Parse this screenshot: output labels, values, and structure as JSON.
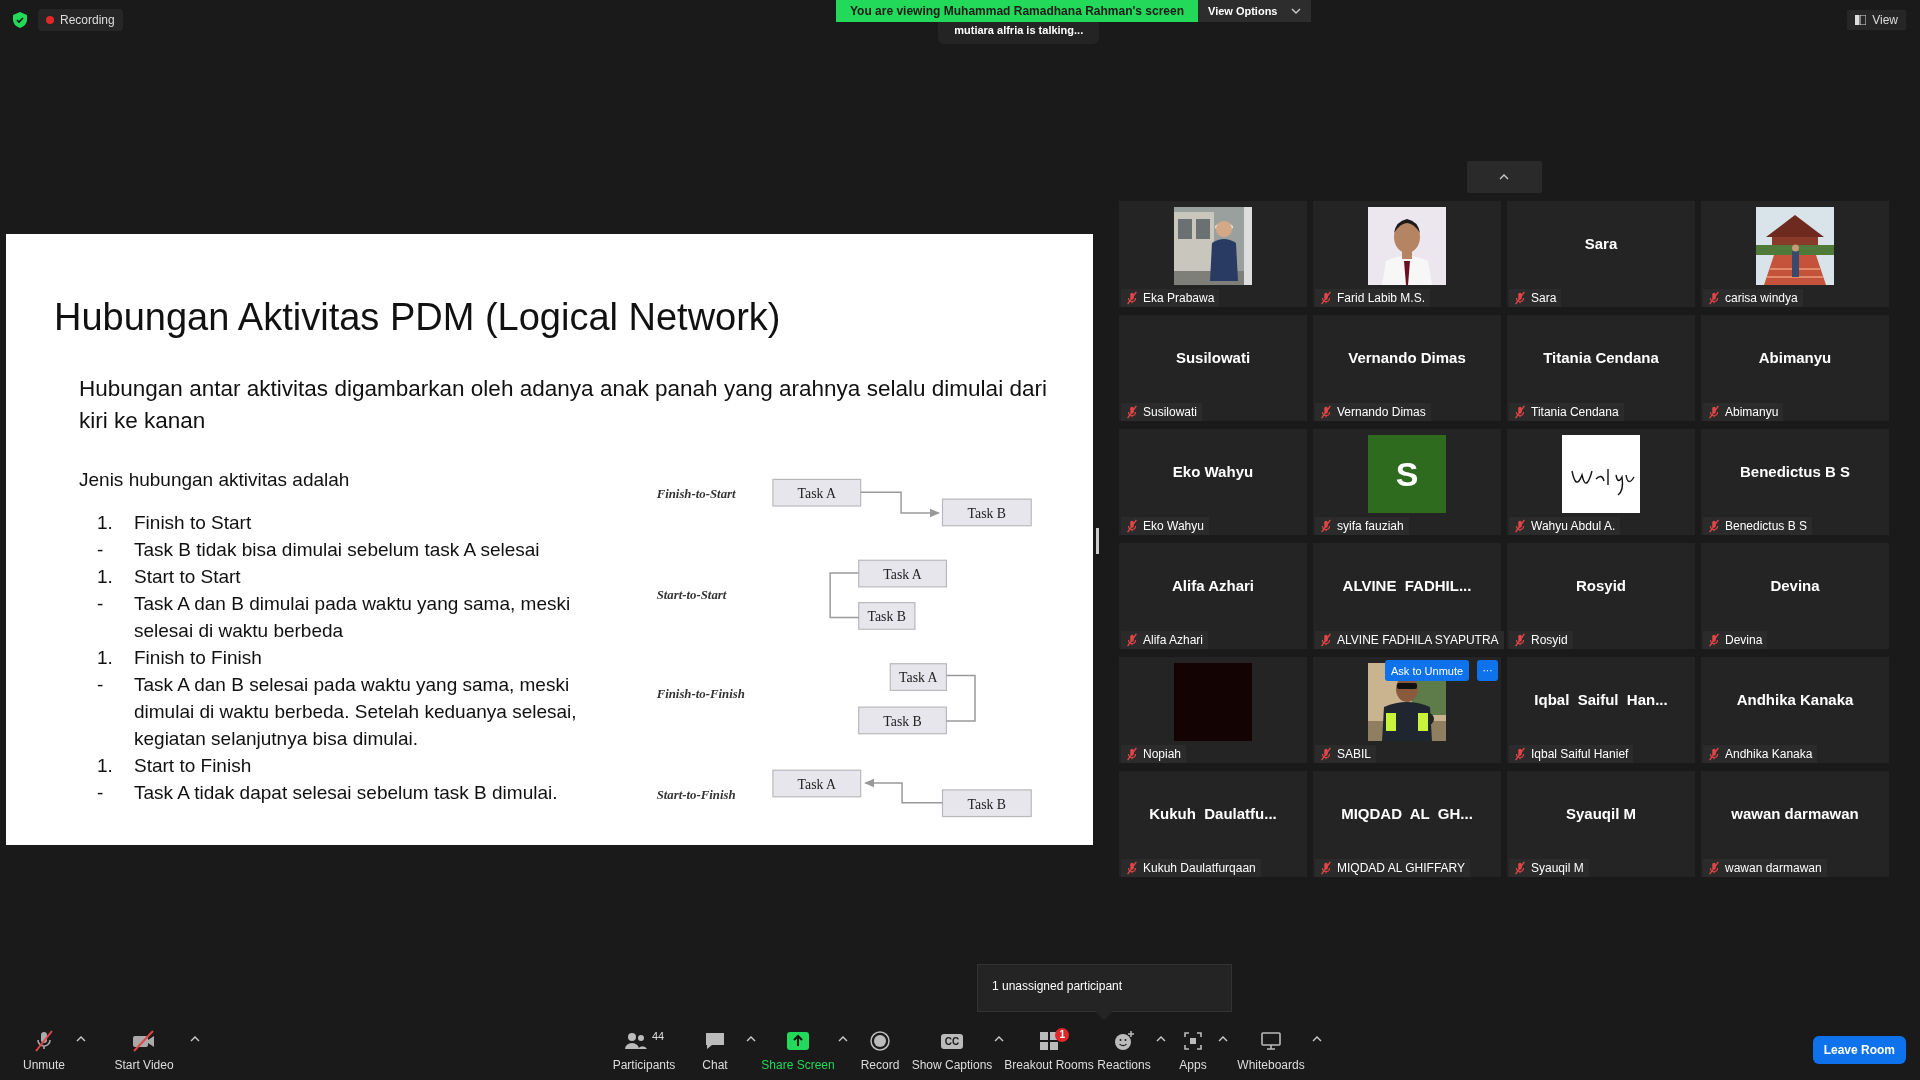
{
  "top_bar": {
    "recording": "Recording",
    "banner": "You are viewing Muhammad Ramadhana Rahman's screen",
    "view_options": "View Options",
    "talking": "mutiara alfria is talking...",
    "view": "View"
  },
  "slide": {
    "title": "Hubungan Aktivitas PDM (Logical Network)",
    "intro": "Hubungan antar aktivitas digambarkan oleh adanya anak panah yang arahnya selalu dimulai dari kiri ke kanan",
    "list_heading": "Jenis hubungan aktivitas adalah",
    "list": [
      {
        "marker": "1.",
        "text": "Finish to Start"
      },
      {
        "marker": "-",
        "text": "Task B tidak bisa dimulai sebelum task A selesai"
      },
      {
        "marker": "1.",
        "text": "Start to Start"
      },
      {
        "marker": "-",
        "text": "Task A dan B dimulai pada waktu yang sama, meski selesai di waktu berbeda"
      },
      {
        "marker": "1.",
        "text": "Finish to Finish"
      },
      {
        "marker": "-",
        "text": "Task A dan B selesai pada waktu yang sama, meski dimulai di waktu berbeda. Setelah keduanya selesai, kegiatan selanjutnya bisa dimulai."
      },
      {
        "marker": "1.",
        "text": "Start to Finish"
      },
      {
        "marker": "-",
        "text": "Task A tidak dapat selesai sebelum task B dimulai."
      }
    ],
    "diagram": [
      {
        "kind": "fs",
        "label": "Finish-to-Start",
        "task_a": "Task A",
        "task_b": "Task B"
      },
      {
        "kind": "ss",
        "label": "Start-to-Start",
        "task_a": "Task A",
        "task_b": "Task B"
      },
      {
        "kind": "ff",
        "label": "Finish-to-Finish",
        "task_a": "Task A",
        "task_b": "Task B"
      },
      {
        "kind": "sf",
        "label": "Start-to-Finish",
        "task_a": "Task A",
        "task_b": "Task B"
      }
    ]
  },
  "gallery": {
    "tiles": [
      {
        "kind": "picture",
        "label": "Eka Prabawa",
        "muted": true
      },
      {
        "kind": "picture",
        "label": "Farid Labib M.S.",
        "muted": true
      },
      {
        "kind": "name",
        "name": "Sara",
        "label": "Sara",
        "muted": true
      },
      {
        "kind": "picture",
        "label": "carisa windya",
        "muted": true
      },
      {
        "kind": "name",
        "name": "Susilowati",
        "label": "Susilowati",
        "muted": true
      },
      {
        "kind": "name",
        "name": "Vernando Dimas",
        "label": "Vernando Dimas",
        "muted": true
      },
      {
        "kind": "name",
        "name": "Titania Cendana",
        "label": "Titania Cendana",
        "muted": true
      },
      {
        "kind": "name",
        "name": "Abimanyu",
        "label": "Abimanyu",
        "muted": true
      },
      {
        "kind": "name",
        "name": "Eko Wahyu",
        "label": "Eko Wahyu",
        "muted": true
      },
      {
        "kind": "avatar",
        "letter": "S",
        "color": "#2e6b1f",
        "label": "syifa fauziah",
        "muted": true
      },
      {
        "kind": "picture",
        "label": "Wahyu Abdul A.",
        "muted": true
      },
      {
        "kind": "name",
        "name": "Benedictus B S",
        "label": "Benedictus B S",
        "muted": true
      },
      {
        "kind": "name",
        "name": "Alifa Azhari",
        "label": "Alifa Azhari",
        "muted": true
      },
      {
        "kind": "name",
        "name": "ALVINE  FADHIL...",
        "label": "ALVINE FADHILA SYAPUTRA",
        "muted": true
      },
      {
        "kind": "name",
        "name": "Rosyid",
        "label": "Rosyid",
        "muted": true
      },
      {
        "kind": "name",
        "name": "Devina",
        "label": "Devina",
        "muted": true
      },
      {
        "kind": "picture",
        "label": "Nopiah",
        "muted": true
      },
      {
        "kind": "picture",
        "label": "SABIL",
        "muted": true,
        "hover_action": "Ask to Unmute",
        "more": "···"
      },
      {
        "kind": "name",
        "name": "Iqbal  Saiful  Han...",
        "label": "Iqbal Saiful Hanief",
        "muted": true
      },
      {
        "kind": "name",
        "name": "Andhika Kanaka",
        "label": "Andhika Kanaka",
        "muted": true
      },
      {
        "kind": "name",
        "name": "Kukuh  Daulatfu...",
        "label": "Kukuh Daulatfurqaan",
        "muted": true
      },
      {
        "kind": "name",
        "name": "MIQDAD  AL  GH...",
        "label": "MIQDAD AL GHIFFARY",
        "muted": true
      },
      {
        "kind": "name",
        "name": "Syauqil M",
        "label": "Syauqil M",
        "muted": true
      },
      {
        "kind": "name",
        "name": "wawan darmawan",
        "label": "wawan darmawan",
        "muted": true
      }
    ]
  },
  "tooltip": "1 unassigned participant",
  "toolbar": {
    "left": [
      {
        "kind": "mic",
        "label": "Unmute",
        "caret": true
      },
      {
        "kind": "video",
        "label": "Start Video",
        "caret": true
      }
    ],
    "center": [
      {
        "kind": "participants",
        "label": "Participants",
        "count": "44",
        "caret": false
      },
      {
        "kind": "chat",
        "label": "Chat",
        "caret": true
      },
      {
        "kind": "share",
        "label": "Share Screen",
        "caret": true,
        "highlight": true
      },
      {
        "kind": "record",
        "label": "Record",
        "caret": false
      },
      {
        "kind": "captions",
        "label": "Show Captions",
        "caret": true,
        "glyph": "CC"
      },
      {
        "kind": "breakout",
        "label": "Breakout Rooms",
        "caret": false,
        "badge": "1"
      },
      {
        "kind": "reactions",
        "label": "Reactions",
        "caret": true
      },
      {
        "kind": "apps",
        "label": "Apps",
        "caret": true
      },
      {
        "kind": "whiteboard",
        "label": "Whiteboards",
        "caret": true
      }
    ],
    "leave": "Leave Room"
  }
}
